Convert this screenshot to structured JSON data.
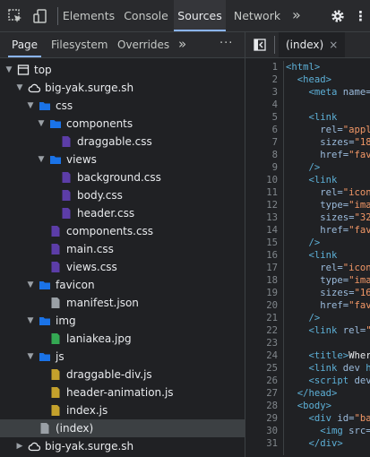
{
  "toolbar": {
    "tabs": [
      "Elements",
      "Console",
      "Sources",
      "Network"
    ],
    "active_tab": "Sources",
    "more": "»"
  },
  "navigator": {
    "tabs": [
      "Page",
      "Filesystem",
      "Overrides"
    ],
    "active_tab": "Page",
    "more": "»",
    "kebab": "⋮"
  },
  "tree": [
    {
      "label": "top",
      "type": "frame",
      "expanded": true
    },
    {
      "label": "big-yak.surge.sh",
      "type": "cloud",
      "expanded": true
    },
    {
      "label": "css",
      "type": "folder",
      "expanded": true
    },
    {
      "label": "components",
      "type": "folder",
      "expanded": true
    },
    {
      "label": "draggable.css",
      "type": "css"
    },
    {
      "label": "views",
      "type": "folder",
      "expanded": true
    },
    {
      "label": "background.css",
      "type": "css"
    },
    {
      "label": "body.css",
      "type": "css"
    },
    {
      "label": "header.css",
      "type": "css"
    },
    {
      "label": "components.css",
      "type": "css"
    },
    {
      "label": "main.css",
      "type": "css"
    },
    {
      "label": "views.css",
      "type": "css"
    },
    {
      "label": "favicon",
      "type": "folder",
      "expanded": true
    },
    {
      "label": "manifest.json",
      "type": "file"
    },
    {
      "label": "img",
      "type": "folder",
      "expanded": true
    },
    {
      "label": "laniakea.jpg",
      "type": "image"
    },
    {
      "label": "js",
      "type": "folder",
      "expanded": true
    },
    {
      "label": "draggable-div.js",
      "type": "js"
    },
    {
      "label": "header-animation.js",
      "type": "js"
    },
    {
      "label": "index.js",
      "type": "js"
    },
    {
      "label": "(index)",
      "type": "file",
      "selected": true
    },
    {
      "label": "big-yak.surge.sh",
      "type": "cloud",
      "expanded": false
    }
  ],
  "editor": {
    "tab_label": "(index)",
    "close": "×",
    "lines": [
      {
        "n": "1",
        "parts": [
          [
            "tag",
            "<html>"
          ]
        ]
      },
      {
        "n": "2",
        "parts": [
          [
            "tag",
            "  <head>"
          ]
        ]
      },
      {
        "n": "3",
        "parts": [
          [
            "tag",
            "    <meta "
          ],
          [
            "attr",
            "name="
          ]
        ]
      },
      {
        "n": "4",
        "parts": []
      },
      {
        "n": "5",
        "parts": [
          [
            "tag",
            "    <link"
          ]
        ]
      },
      {
        "n": "6",
        "parts": [
          [
            "attr",
            "      rel="
          ],
          [
            "val",
            "\"appl"
          ]
        ]
      },
      {
        "n": "7",
        "parts": [
          [
            "attr",
            "      sizes="
          ],
          [
            "val",
            "\"18"
          ]
        ]
      },
      {
        "n": "8",
        "parts": [
          [
            "attr",
            "      href="
          ],
          [
            "val",
            "\"fav"
          ]
        ]
      },
      {
        "n": "9",
        "parts": [
          [
            "tag",
            "    />"
          ]
        ]
      },
      {
        "n": "10",
        "parts": [
          [
            "tag",
            "    <link"
          ]
        ]
      },
      {
        "n": "11",
        "parts": [
          [
            "attr",
            "      rel="
          ],
          [
            "val",
            "\"icon"
          ]
        ]
      },
      {
        "n": "12",
        "parts": [
          [
            "attr",
            "      type="
          ],
          [
            "val",
            "\"ima"
          ]
        ]
      },
      {
        "n": "13",
        "parts": [
          [
            "attr",
            "      sizes="
          ],
          [
            "val",
            "\"32"
          ]
        ]
      },
      {
        "n": "14",
        "parts": [
          [
            "attr",
            "      href="
          ],
          [
            "val",
            "\"fav"
          ]
        ]
      },
      {
        "n": "15",
        "parts": [
          [
            "tag",
            "    />"
          ]
        ]
      },
      {
        "n": "16",
        "parts": [
          [
            "tag",
            "    <link"
          ]
        ]
      },
      {
        "n": "17",
        "parts": [
          [
            "attr",
            "      rel="
          ],
          [
            "val",
            "\"icon"
          ]
        ]
      },
      {
        "n": "18",
        "parts": [
          [
            "attr",
            "      type="
          ],
          [
            "val",
            "\"ima"
          ]
        ]
      },
      {
        "n": "19",
        "parts": [
          [
            "attr",
            "      sizes="
          ],
          [
            "val",
            "\"16"
          ]
        ]
      },
      {
        "n": "20",
        "parts": [
          [
            "attr",
            "      href="
          ],
          [
            "val",
            "\"fav"
          ]
        ]
      },
      {
        "n": "21",
        "parts": [
          [
            "tag",
            "    />"
          ]
        ]
      },
      {
        "n": "22",
        "parts": [
          [
            "tag",
            "    <link "
          ],
          [
            "attr",
            "rel="
          ],
          [
            "val",
            "\""
          ]
        ]
      },
      {
        "n": "23",
        "parts": []
      },
      {
        "n": "24",
        "parts": [
          [
            "tag",
            "    <title>"
          ],
          [
            "txt",
            "Wher"
          ]
        ]
      },
      {
        "n": "25",
        "parts": [
          [
            "tag",
            "    <link "
          ],
          [
            "attr",
            "dev "
          ],
          [
            "tag",
            "h"
          ]
        ]
      },
      {
        "n": "26",
        "parts": [
          [
            "tag",
            "    <script "
          ],
          [
            "attr",
            "dev"
          ]
        ]
      },
      {
        "n": "27",
        "parts": [
          [
            "tag",
            "  </head>"
          ]
        ]
      },
      {
        "n": "28",
        "parts": [
          [
            "tag",
            "  <body>"
          ]
        ]
      },
      {
        "n": "29",
        "parts": [
          [
            "tag",
            "    <div "
          ],
          [
            "attr",
            "id="
          ],
          [
            "val",
            "\"ba"
          ]
        ]
      },
      {
        "n": "30",
        "parts": [
          [
            "tag",
            "      <img "
          ],
          [
            "attr",
            "src="
          ]
        ]
      },
      {
        "n": "31",
        "parts": [
          [
            "tag",
            "    </div>"
          ]
        ]
      }
    ]
  },
  "colors": {
    "css": "#5c3da8",
    "js": "#c4a12c",
    "folder": "#1a73e8",
    "json_file": "#9aa0a6",
    "image": "#34a853",
    "accent": "#8ab4f8"
  }
}
